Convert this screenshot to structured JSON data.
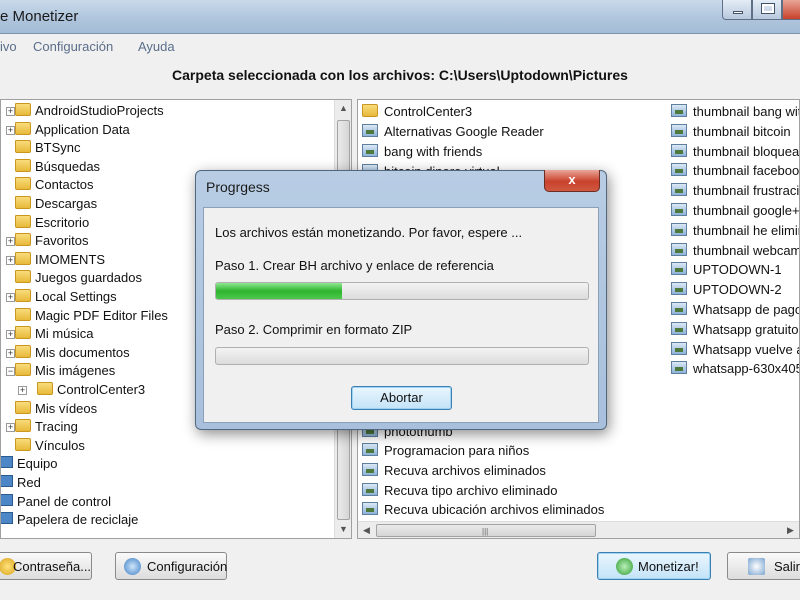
{
  "app": {
    "title": "e Monetizer",
    "menu": [
      "ivo",
      "Configuración",
      "Ayuda"
    ],
    "folder_header": "Carpeta seleccionada con los archivos: C:\\Users\\Uptodown\\Pictures"
  },
  "tree": {
    "items": [
      {
        "label": "AndroidStudioProjects",
        "expand": "+"
      },
      {
        "label": "Application Data",
        "expand": "+"
      },
      {
        "label": "BTSync",
        "expand": ""
      },
      {
        "label": "Búsquedas",
        "expand": ""
      },
      {
        "label": "Contactos",
        "expand": ""
      },
      {
        "label": "Descargas",
        "expand": ""
      },
      {
        "label": "Escritorio",
        "expand": ""
      },
      {
        "label": "Favoritos",
        "expand": "+"
      },
      {
        "label": "IMOMENTS",
        "expand": "+"
      },
      {
        "label": "Juegos guardados",
        "expand": ""
      },
      {
        "label": "Local Settings",
        "expand": "+"
      },
      {
        "label": "Magic PDF Editor Files",
        "expand": ""
      },
      {
        "label": "Mi música",
        "expand": "+"
      },
      {
        "label": "Mis documentos",
        "expand": "+"
      },
      {
        "label": "Mis imágenes",
        "expand": "−"
      },
      {
        "label": "ControlCenter3",
        "expand": "+"
      },
      {
        "label": "Mis vídeos",
        "expand": ""
      },
      {
        "label": "Tracing",
        "expand": "+"
      },
      {
        "label": "Vínculos",
        "expand": ""
      },
      {
        "label": "Equipo",
        "expand": ""
      },
      {
        "label": "Red",
        "expand": ""
      },
      {
        "label": "Panel de control",
        "expand": ""
      },
      {
        "label": "Papelera de reciclaje",
        "expand": ""
      }
    ]
  },
  "files_left": [
    {
      "label": "ControlCenter3",
      "icon": "folder-icon"
    },
    {
      "label": "Alternativas Google Reader",
      "icon": "image-file-icon"
    },
    {
      "label": "bang with friends",
      "icon": "image-file-icon"
    },
    {
      "label": "bitcoin dinero virtual",
      "icon": "image-file-icon"
    },
    {
      "label": "photothumb",
      "icon": "image-file-icon"
    },
    {
      "label": "Programacion para niños",
      "icon": "image-file-icon"
    },
    {
      "label": "Recuva archivos eliminados",
      "icon": "image-file-icon"
    },
    {
      "label": "Recuva tipo archivo eliminado",
      "icon": "image-file-icon"
    },
    {
      "label": "Recuva ubicación archivos eliminados",
      "icon": "image-file-icon"
    }
  ],
  "files_right": [
    {
      "label": "thumbnail bang with",
      "icon": "image-file-icon"
    },
    {
      "label": "thumbnail bitcoin",
      "icon": "image-file-icon"
    },
    {
      "label": "thumbnail bloquear",
      "icon": "image-file-icon"
    },
    {
      "label": "thumbnail facebook",
      "icon": "image-file-icon"
    },
    {
      "label": "thumbnail frustración",
      "icon": "image-file-icon"
    },
    {
      "label": "thumbnail google+ c",
      "icon": "image-file-icon"
    },
    {
      "label": "thumbnail he elimina",
      "icon": "image-file-icon"
    },
    {
      "label": "thumbnail webcam",
      "icon": "image-file-icon"
    },
    {
      "label": "UPTODOWN-1",
      "icon": "image-file-icon"
    },
    {
      "label": "UPTODOWN-2",
      "icon": "image-file-icon"
    },
    {
      "label": "Whatsapp de pago",
      "icon": "image-file-icon"
    },
    {
      "label": "Whatsapp gratuito",
      "icon": "image-file-icon"
    },
    {
      "label": "Whatsapp vuelve a",
      "icon": "image-file-icon"
    },
    {
      "label": "whatsapp-630x405",
      "icon": "image-file-icon"
    }
  ],
  "buttons": {
    "password": "Contraseña...",
    "config": "Configuración",
    "monetize": "Monetizar!",
    "exit": "Salir"
  },
  "dialog": {
    "title": "Progrgess",
    "close_glyph": "x",
    "message": "Los archivos están monetizando. Por favor, espere ...",
    "step1_label": "Paso 1. Crear BH archivo y enlace de referencia",
    "step1_progress": 0.34,
    "step2_label": "Paso 2. Comprimir en formato ZIP",
    "step2_progress": 0,
    "abort_label": "Abortar"
  },
  "colors": {
    "progress_green": "#2fb52f",
    "focus_blue": "#3c7fb1",
    "menu_text": "#5a6e8a"
  }
}
